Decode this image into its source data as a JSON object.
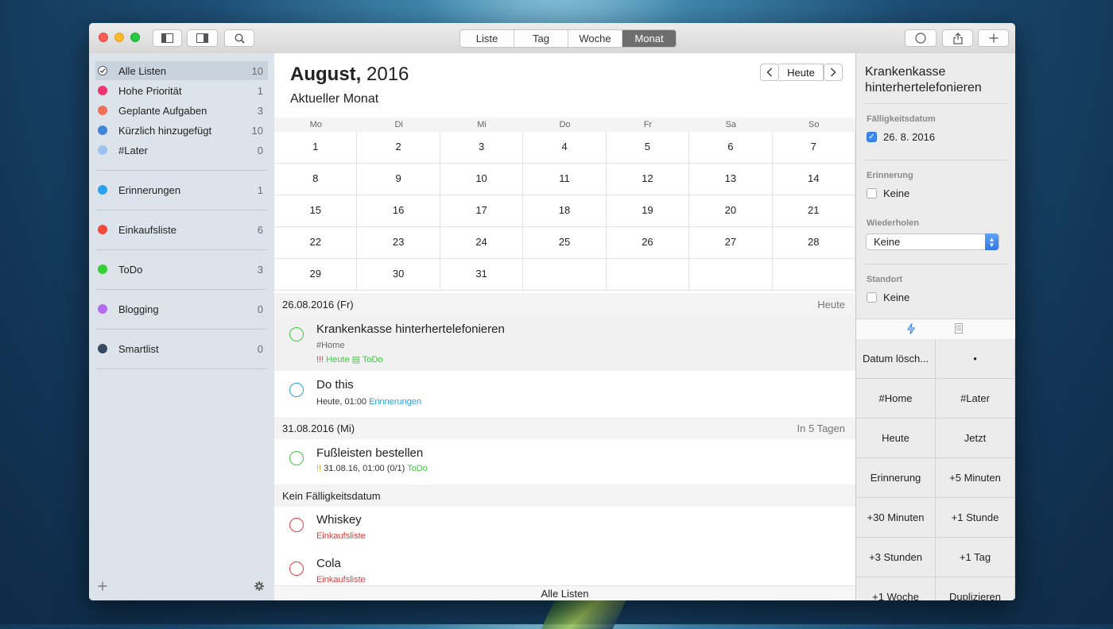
{
  "toolbar": {
    "view_tabs": [
      "Liste",
      "Tag",
      "Woche",
      "Monat"
    ],
    "active_tab": "Monat"
  },
  "sidebar": {
    "smart_lists": [
      {
        "label": "Alle Listen",
        "count": "10",
        "color": "#ffffff"
      },
      {
        "label": "Hohe Priorität",
        "count": "1",
        "color": "#f0356e"
      },
      {
        "label": "Geplante Aufgaben",
        "count": "3",
        "color": "#f07159"
      },
      {
        "label": "Kürzlich hinzugefügt",
        "count": "10",
        "color": "#3f86d8"
      },
      {
        "label": "#Later",
        "count": "0",
        "color": "#9ec3f0"
      }
    ],
    "lists": [
      {
        "label": "Erinnerungen",
        "count": "1",
        "color": "#2aa0f0"
      },
      {
        "label": "Einkaufsliste",
        "count": "6",
        "color": "#f04a3a"
      },
      {
        "label": "ToDo",
        "count": "3",
        "color": "#34d034"
      },
      {
        "label": "Blogging",
        "count": "0",
        "color": "#b56cf0"
      },
      {
        "label": "Smartlist",
        "count": "0",
        "color": "#344b63"
      }
    ]
  },
  "calendar": {
    "month": "August,",
    "year": "2016",
    "subtitle": "Aktueller Monat",
    "today_label": "Heute",
    "weekdays": [
      "Mo",
      "Di",
      "Mi",
      "Do",
      "Fr",
      "Sa",
      "So"
    ],
    "days": [
      "1",
      "2",
      "3",
      "4",
      "5",
      "6",
      "7",
      "8",
      "9",
      "10",
      "11",
      "12",
      "13",
      "14",
      "15",
      "16",
      "17",
      "18",
      "19",
      "20",
      "21",
      "22",
      "23",
      "24",
      "25",
      "26",
      "27",
      "28",
      "29",
      "30",
      "31"
    ]
  },
  "sections": [
    {
      "date": "26.08.2016 (Fr)",
      "relative": "Heute"
    },
    {
      "date": "31.08.2016 (Mi)",
      "relative": "In 5 Tagen"
    },
    {
      "date": "Kein Fälligkeitsdatum",
      "relative": ""
    }
  ],
  "tasks": [
    {
      "title": "Krankenkasse hinterhertelefonieren",
      "tag": "#Home",
      "priority": "!!!",
      "due": "Heute",
      "list": "ToDo"
    },
    {
      "title": "Do this",
      "due": "Heute, 01:00",
      "list": "Erinnerungen"
    },
    {
      "title": "Fußleisten bestellen",
      "priority": "!!",
      "due": "31.08.16, 01:00 (0/1)",
      "list": "ToDo"
    },
    {
      "title": "Whiskey",
      "list": "Einkaufsliste"
    },
    {
      "title": "Cola",
      "list": "Einkaufsliste"
    }
  ],
  "footer": {
    "label": "Alle Listen"
  },
  "inspector": {
    "title": "Krankenkasse hinterhertelefonieren",
    "due_label": "Fälligkeitsdatum",
    "due_value": "26. 8. 2016",
    "reminder_label": "Erinnerung",
    "reminder_value": "Keine",
    "repeat_label": "Wiederholen",
    "repeat_value": "Keine",
    "location_label": "Standort",
    "location_value": "Keine",
    "quick_actions": [
      "Datum lösch...",
      "•",
      "#Home",
      "#Later",
      "Heute",
      "Jetzt",
      "Erinnerung",
      "+5 Minuten",
      "+30 Minuten",
      "+1 Stunde",
      "+3 Stunden",
      "+1 Tag",
      "+1 Woche",
      "Duplizieren"
    ]
  }
}
